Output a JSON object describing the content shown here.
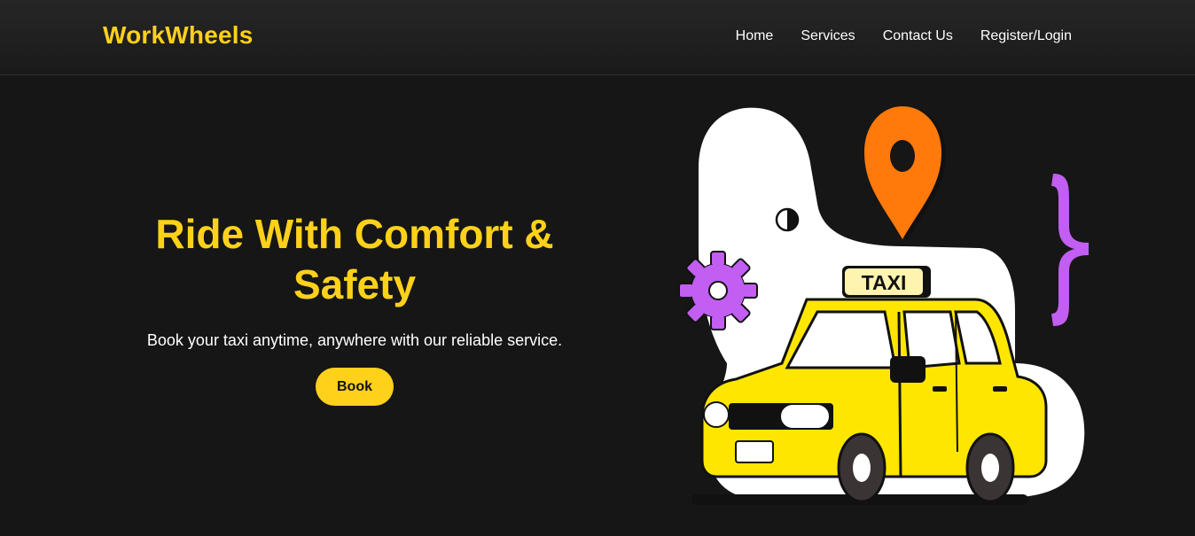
{
  "header": {
    "brand": "WorkWheels",
    "nav": [
      "Home",
      "Services",
      "Contact Us",
      "Register/Login"
    ]
  },
  "hero": {
    "title_line1": "Ride With Comfort &",
    "title_line2": "Safety",
    "subtitle": "Book your taxi anytime, anywhere with our reliable service.",
    "button_label": "Book"
  },
  "illustration": {
    "sign_text": "TAXI",
    "icons": [
      "location-pin-icon",
      "gear-icon",
      "curly-brace-icon",
      "taxi-car-icon"
    ]
  },
  "colors": {
    "background": "#161616",
    "accent": "#ffd11a",
    "pin": "#ff7a0a",
    "purple": "#c25ef2",
    "car": "#ffe600"
  }
}
